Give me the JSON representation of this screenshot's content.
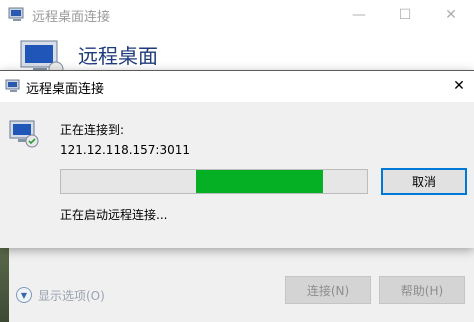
{
  "background_window": {
    "title": "远程桌面连接",
    "heading": "远程桌面",
    "controls": {
      "minimize": "—",
      "maximize": "☐",
      "close": "✕"
    },
    "show_options_label": "显示选项(O)",
    "connect_button": "连接(N)",
    "help_button": "帮助(H)"
  },
  "dialog": {
    "title": "远程桌面连接",
    "close_glyph": "✕",
    "status_heading": "正在连接到:",
    "address": "121.12.118.157:3011",
    "progress": {
      "start_fraction": 0.44,
      "end_fraction": 0.855,
      "color": "#06b025"
    },
    "cancel_label": "取消",
    "status_text": "正在启动远程连接..."
  },
  "colors": {
    "accent": "#0078d7",
    "heading_blue": "#1e3b7b"
  },
  "icons": [
    "remote-desktop-icon",
    "close-icon",
    "minimize-icon",
    "maximize-icon",
    "chevron-down-icon"
  ]
}
